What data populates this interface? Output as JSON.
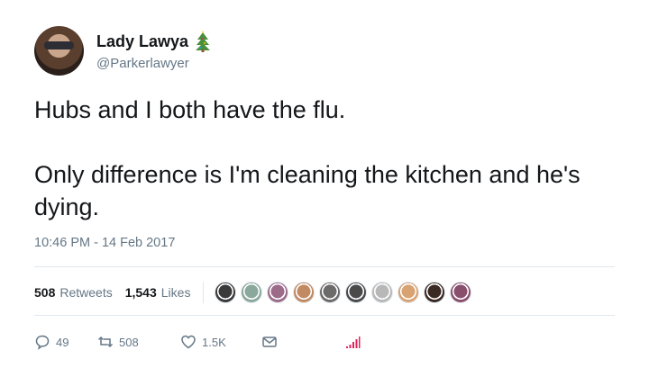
{
  "author": {
    "name": "Lady Lawya",
    "handle": "@Parkerlawyer",
    "badge_icon": "christmas-tree-icon"
  },
  "tweet": {
    "line1": "Hubs and I both have the flu.",
    "line2": "Only difference is I'm cleaning the kitchen and he's dying.",
    "timestamp": "10:46 PM - 14 Feb 2017"
  },
  "stats": {
    "retweets_count": "508",
    "retweets_label": "Retweets",
    "likes_count": "1,543",
    "likes_label": "Likes",
    "liker_avatar_colors": [
      "#3a3a3a",
      "#8aa89c",
      "#9c6b8a",
      "#c28a63",
      "#6d6a6a",
      "#4a4a4a",
      "#b8b8b8",
      "#d9a273",
      "#3b2a24",
      "#8b4f6e"
    ]
  },
  "actions": {
    "reply_count": "49",
    "retweet_count": "508",
    "like_count": "1.5K"
  },
  "colors": {
    "text": "#14171a",
    "muted": "#657786",
    "divider": "#e1e8ed",
    "analytics": "#e0245e"
  }
}
